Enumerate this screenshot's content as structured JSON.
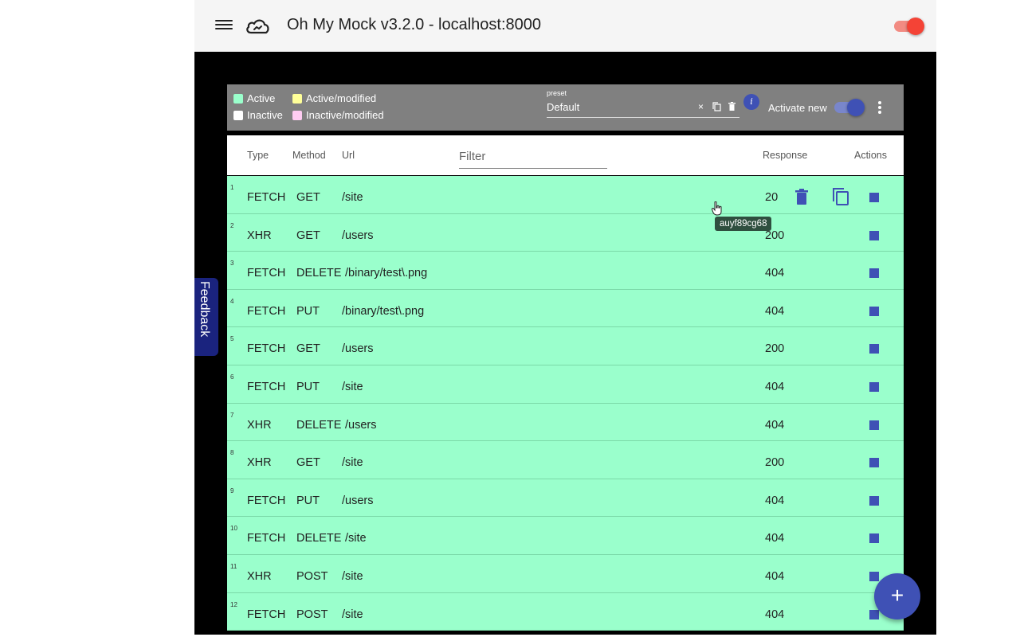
{
  "toolbar": {
    "title": "Oh My Mock v3.2.0 - localhost:8000",
    "menu_icon": "menu-icon",
    "logo_icon": "cloud-icon",
    "enabled": true
  },
  "legend": {
    "active": "Active",
    "active_modified": "Active/modified",
    "inactive": "Inactive",
    "inactive_modified": "Inactive/modified",
    "colors": {
      "active": "#9affcc",
      "active_modified": "#ffff99",
      "inactive": "#ffffff",
      "inactive_modified": "#ffccf2"
    }
  },
  "preset": {
    "label": "preset",
    "value": "Default",
    "clear": "×"
  },
  "info": "i",
  "activate_new": {
    "label": "Activate new",
    "enabled": true
  },
  "table": {
    "headers": {
      "type": "Type",
      "method": "Method",
      "url": "Url",
      "response": "Response",
      "actions": "Actions"
    },
    "filter_placeholder": "Filter",
    "rows": [
      {
        "idx": "1",
        "type": "FETCH",
        "method": "GET",
        "url": "/site",
        "response": "20"
      },
      {
        "idx": "2",
        "type": "XHR",
        "method": "GET",
        "url": "/users",
        "response": "200"
      },
      {
        "idx": "3",
        "type": "FETCH",
        "method": "DELETE",
        "url": "/binary/test\\.png",
        "response": "404"
      },
      {
        "idx": "4",
        "type": "FETCH",
        "method": "PUT",
        "url": "/binary/test\\.png",
        "response": "404"
      },
      {
        "idx": "5",
        "type": "FETCH",
        "method": "GET",
        "url": "/users",
        "response": "200"
      },
      {
        "idx": "6",
        "type": "FETCH",
        "method": "PUT",
        "url": "/site",
        "response": "404"
      },
      {
        "idx": "7",
        "type": "XHR",
        "method": "DELETE",
        "url": "/users",
        "response": "404"
      },
      {
        "idx": "8",
        "type": "XHR",
        "method": "GET",
        "url": "/site",
        "response": "200"
      },
      {
        "idx": "9",
        "type": "FETCH",
        "method": "PUT",
        "url": "/users",
        "response": "404"
      },
      {
        "idx": "10",
        "type": "FETCH",
        "method": "DELETE",
        "url": "/site",
        "response": "404"
      },
      {
        "idx": "11",
        "type": "XHR",
        "method": "POST",
        "url": "/site",
        "response": "404"
      },
      {
        "idx": "12",
        "type": "FETCH",
        "method": "POST",
        "url": "/site",
        "response": "404"
      }
    ]
  },
  "tooltip": "auyf89cg68",
  "feedback": "Feedback",
  "fab": "+"
}
